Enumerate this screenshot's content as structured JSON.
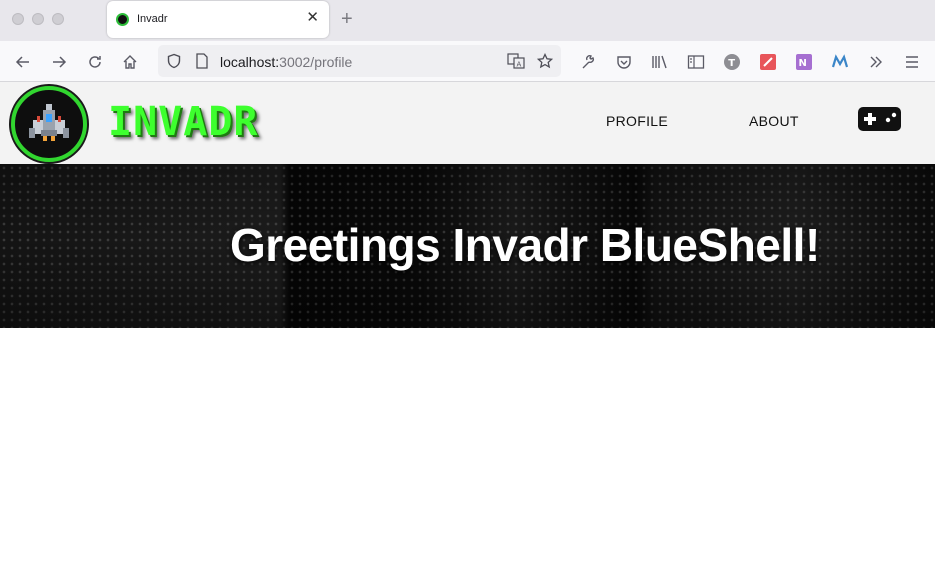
{
  "browser": {
    "tab": {
      "title": "Invadr"
    },
    "url": {
      "host": "localhost:",
      "port_path": "3002/profile"
    }
  },
  "app": {
    "brand": "INVADR",
    "nav": [
      {
        "label": "PROFILE"
      },
      {
        "label": "ABOUT"
      }
    ],
    "hero": {
      "greeting": "Greetings Invadr BlueShell!"
    }
  },
  "colors": {
    "brand_green": "#3dff2e",
    "header_bg": "#f3f3f3",
    "hero_bg": "#0c0c0c"
  }
}
